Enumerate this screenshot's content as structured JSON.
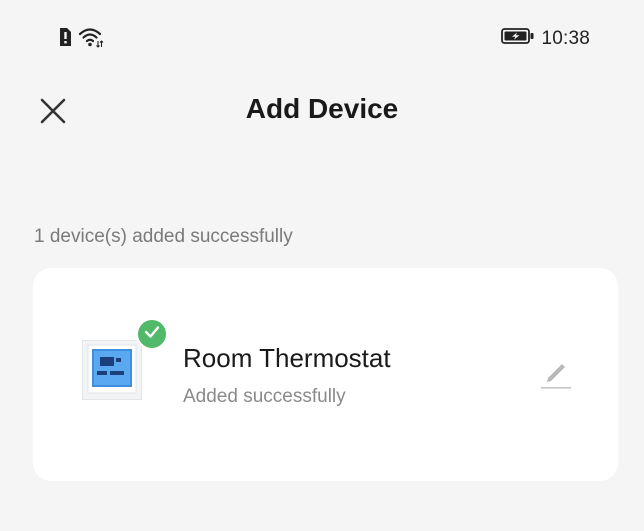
{
  "status_bar": {
    "time": "10:38",
    "icons": [
      "sim-alert-icon",
      "wifi-icon",
      "battery-charging-icon"
    ]
  },
  "header": {
    "title": "Add Device",
    "close_icon": "close-icon"
  },
  "summary": {
    "text": "1 device(s) added successfully"
  },
  "device": {
    "name": "Room Thermostat",
    "status": "Added successfully",
    "thumbnail": "thermostat-image",
    "badge_icon": "check-icon",
    "edit_icon": "pencil-icon"
  },
  "colors": {
    "background": "#f5f5f5",
    "card": "#ffffff",
    "success_green": "#53b96a",
    "secondary_text": "#8a8a8a"
  }
}
